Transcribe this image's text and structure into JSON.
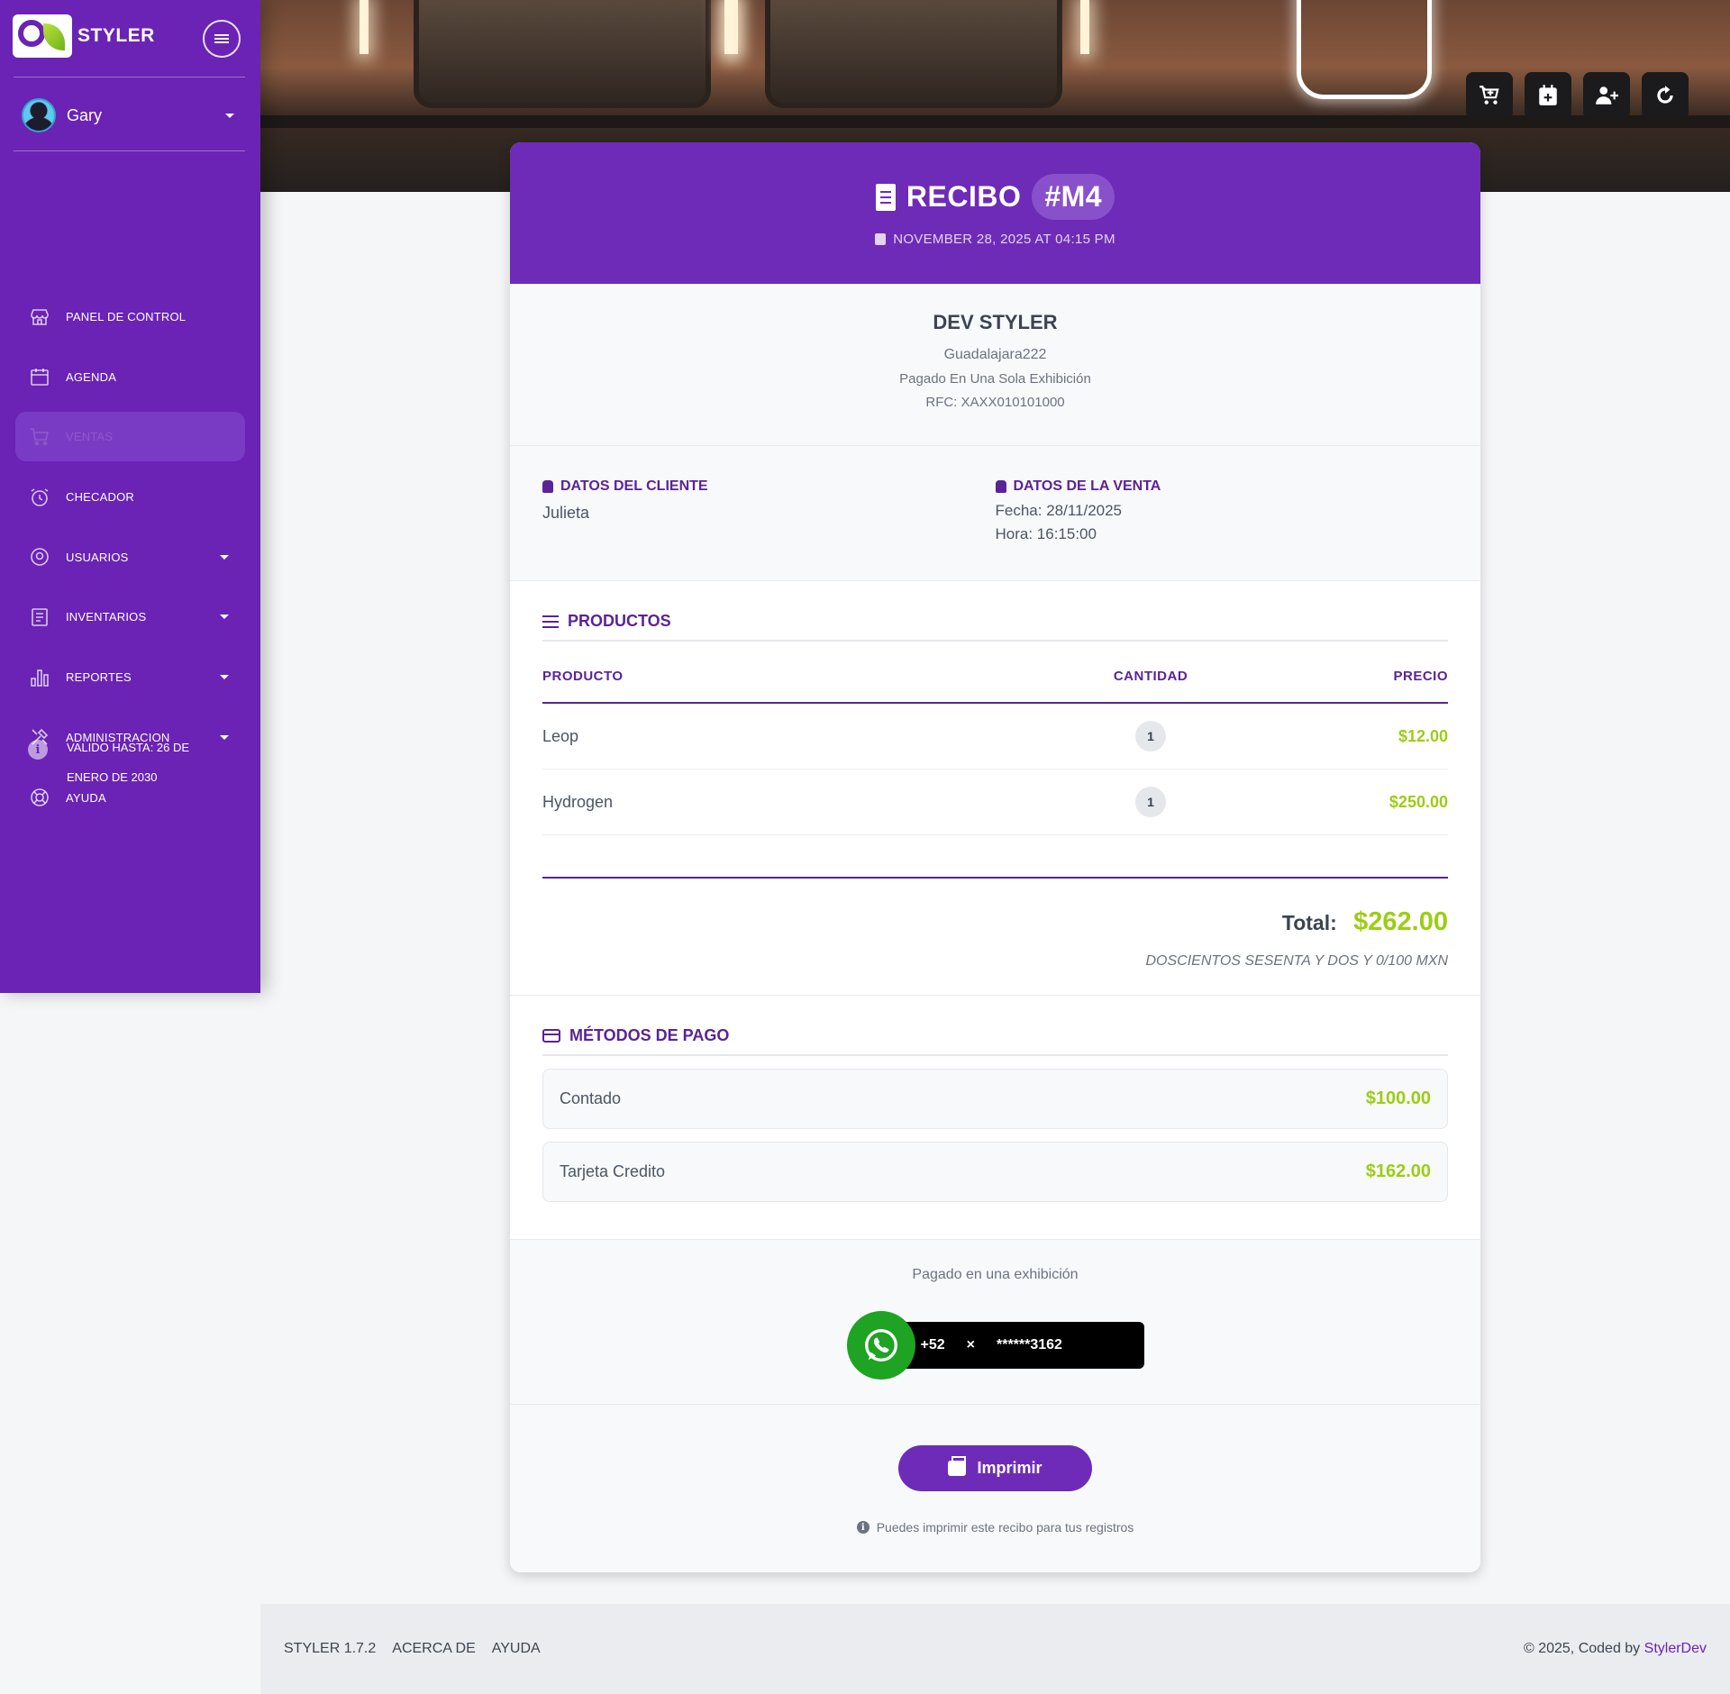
{
  "brand": {
    "name": "STYLER"
  },
  "user": {
    "name": "Gary"
  },
  "nav": [
    {
      "label": "PANEL DE CONTROL",
      "icon": "store-icon",
      "caret": false,
      "active": false
    },
    {
      "label": "AGENDA",
      "icon": "calendar-icon",
      "caret": false,
      "active": false
    },
    {
      "label": "VENTAS",
      "icon": "cart-icon",
      "caret": false,
      "active": true
    },
    {
      "label": "CHECADOR",
      "icon": "alarm-clock-icon",
      "caret": false,
      "active": false
    },
    {
      "label": "USUARIOS",
      "icon": "user-circle-icon",
      "caret": true,
      "active": false
    },
    {
      "label": "INVENTARIOS",
      "icon": "document-list-icon",
      "caret": true,
      "active": false
    },
    {
      "label": "REPORTES",
      "icon": "bar-chart-icon",
      "caret": true,
      "active": false
    },
    {
      "label": "ADMINISTRACION",
      "icon": "tools-icon",
      "caret": true,
      "active": false
    },
    {
      "label": "AYUDA",
      "icon": "lifebuoy-icon",
      "caret": false,
      "active": false
    }
  ],
  "license": {
    "text": "VALIDO HASTA: 26 DE ENERO DE 2030"
  },
  "toolbar": [
    "cart-plus-icon",
    "calendar-plus-icon",
    "user-plus-icon",
    "refresh-icon"
  ],
  "receipt": {
    "title": "RECIBO",
    "number": "#M4",
    "datetime": "NOVEMBER 28, 2025 AT 04:15 PM",
    "business": {
      "name": "DEV STYLER",
      "address": "Guadalajara222",
      "payment_mode": "Pagado En Una Sola Exhibición",
      "rfc": "RFC: XAXX010101000"
    },
    "client": {
      "label": "DATOS DEL CLIENTE",
      "name": "Julieta"
    },
    "sale": {
      "label": "DATOS DE LA VENTA",
      "date": "Fecha: 28/11/2025",
      "time": "Hora: 16:15:00"
    },
    "products": {
      "title": "PRODUCTOS",
      "headers": {
        "product": "PRODUCTO",
        "qty": "CANTIDAD",
        "price": "PRECIO"
      },
      "rows": [
        {
          "name": "Leop",
          "qty": "1",
          "price": "$12.00"
        },
        {
          "name": "Hydrogen",
          "qty": "1",
          "price": "$250.00"
        }
      ]
    },
    "total_label": "Total:",
    "total": "$262.00",
    "total_words": "DOSCIENTOS SESENTA Y DOS Y 0/100 MXN",
    "payments": {
      "title": "MÉTODOS DE PAGO",
      "items": [
        {
          "method": "Contado",
          "amount": "$100.00"
        },
        {
          "method": "Tarjeta Credito",
          "amount": "$162.00"
        }
      ]
    },
    "paid_note": "Pagado en una exhibición",
    "whatsapp": {
      "code": "+52",
      "separator": "×",
      "number": "******3162"
    },
    "print_label": "Imprimir",
    "print_hint": "Puedes imprimir este recibo para tus registros"
  },
  "footer": {
    "links": [
      "STYLER 1.7.2",
      "ACERCA DE",
      "AYUDA"
    ],
    "copyright": "© 2025, Coded by",
    "copyright_link": "StylerDev"
  },
  "colors": {
    "primary": "#6a23b5",
    "accent_green": "#9ccd14",
    "whatsapp": "#1ea323"
  }
}
